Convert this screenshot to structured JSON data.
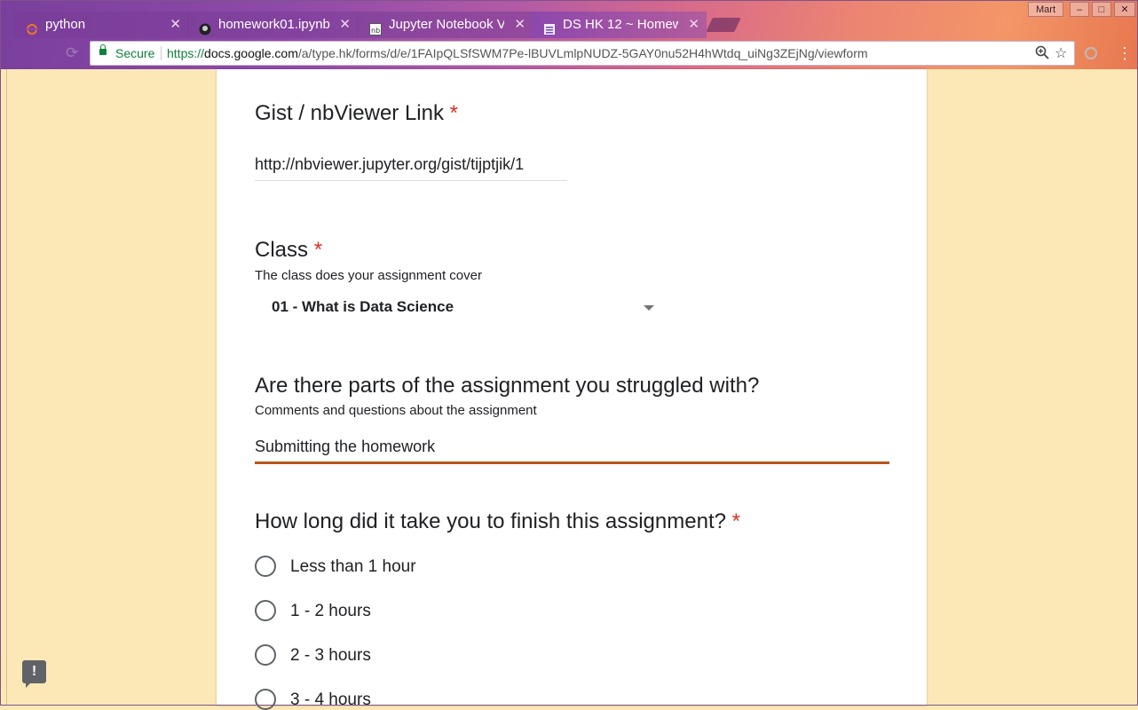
{
  "browser": {
    "tabs": [
      {
        "title": "python",
        "icon": "python-ring-icon"
      },
      {
        "title": "homework01.ipynb",
        "icon": "github-icon"
      },
      {
        "title": "Jupyter Notebook V",
        "icon": "nbviewer-icon"
      },
      {
        "title": "DS HK 12 ~ Homew",
        "icon": "forms-icon"
      }
    ],
    "user_label": "Mart",
    "secure_label": "Secure",
    "url_scheme": "https://",
    "url_host": "docs.google.com",
    "url_path": "/a/type.hk/forms/d/e/1FAIpQLSfSWM7Pe-lBUVLmlpNUDZ-5GAY0nu52H4hWtdq_uiNg3ZEjNg/viewform",
    "window_controls": [
      "–",
      "□",
      "✕"
    ]
  },
  "form": {
    "q_link": {
      "title": "Gist / nbViewer Link",
      "required": "*",
      "value": "http://nbviewer.jupyter.org/gist/tijptjik/1"
    },
    "q_class": {
      "title": "Class",
      "required": "*",
      "description": "The class does your assignment cover",
      "selected": "01 - What is Data Science"
    },
    "q_struggle": {
      "title": "Are there parts of the assignment you struggled with?",
      "description": "Comments and questions about the assignment",
      "value": "Submitting the homework"
    },
    "q_duration": {
      "title": "How long did it take you to finish this assignment?",
      "required": "*",
      "options": [
        "Less than 1 hour",
        "1 - 2 hours",
        "2 - 3 hours",
        "3 - 4 hours"
      ]
    }
  },
  "colors": {
    "required": "#d93025",
    "focus_underline": "#b5561b",
    "secure": "#11803a"
  }
}
